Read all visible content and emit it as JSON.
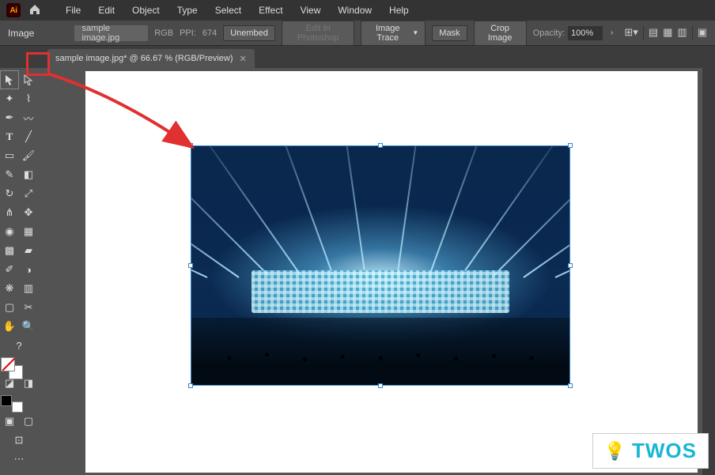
{
  "app": {
    "icon_text": "Ai"
  },
  "menu": {
    "items": [
      "File",
      "Edit",
      "Object",
      "Type",
      "Select",
      "Effect",
      "View",
      "Window",
      "Help"
    ]
  },
  "control_strip": {
    "mode": "Image",
    "filename": "sample image.jpg",
    "color_mode": "RGB",
    "ppi_label": "PPI:",
    "ppi_value": "674",
    "unembed": "Unembed",
    "edit_in_ps": "Edit In Photoshop",
    "image_trace": "Image Trace",
    "mask": "Mask",
    "crop": "Crop Image",
    "opacity_label": "Opacity:",
    "opacity_value": "100%"
  },
  "document": {
    "tab_title": "sample image.jpg* @ 66.67 % (RGB/Preview)"
  },
  "watermark": {
    "text": "TWOS"
  },
  "tools": {
    "help_label": "?"
  }
}
